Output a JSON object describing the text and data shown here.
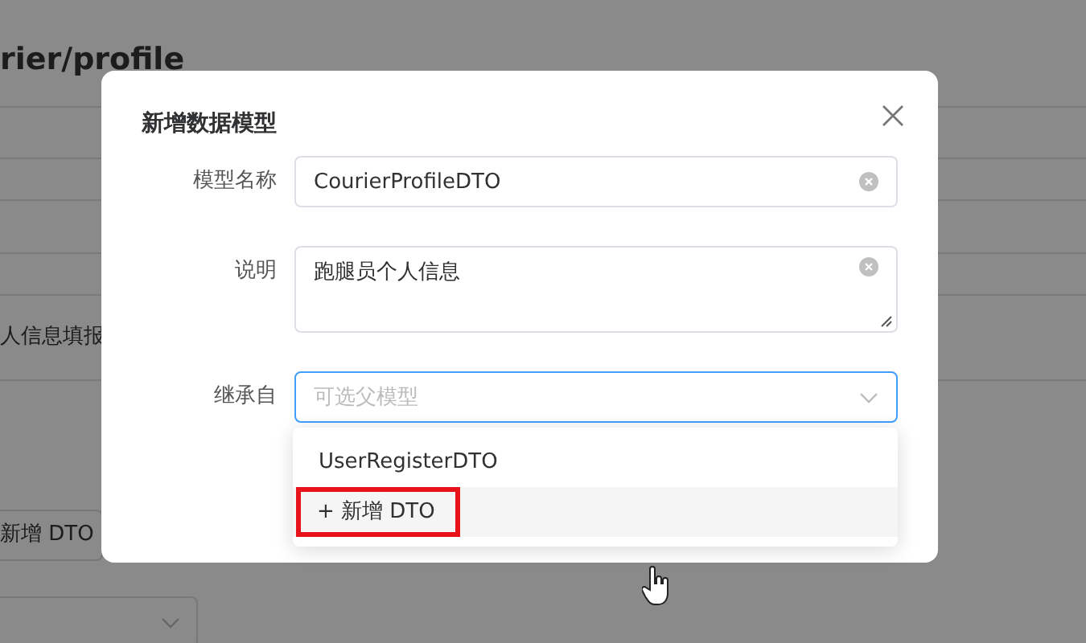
{
  "background_page": {
    "heading": "rier/profile",
    "text": "人信息填报",
    "button": "新增 DTO"
  },
  "dialog": {
    "title": "新增数据模型",
    "fields": [
      {
        "kind": "input",
        "label": "模型名称",
        "value": "CourierProfileDTO"
      },
      {
        "kind": "textarea",
        "label": "说明",
        "value": "跑腿员个人信息"
      },
      {
        "kind": "select",
        "label": "继承自",
        "placeholder": "可选父模型",
        "focused": true
      }
    ]
  },
  "dropdown": {
    "options": [
      {
        "label": "UserRegisterDTO",
        "hovered": false,
        "highlighted": false
      },
      {
        "label": "+ 新增 DTO",
        "hovered": true,
        "highlighted": true
      }
    ]
  }
}
